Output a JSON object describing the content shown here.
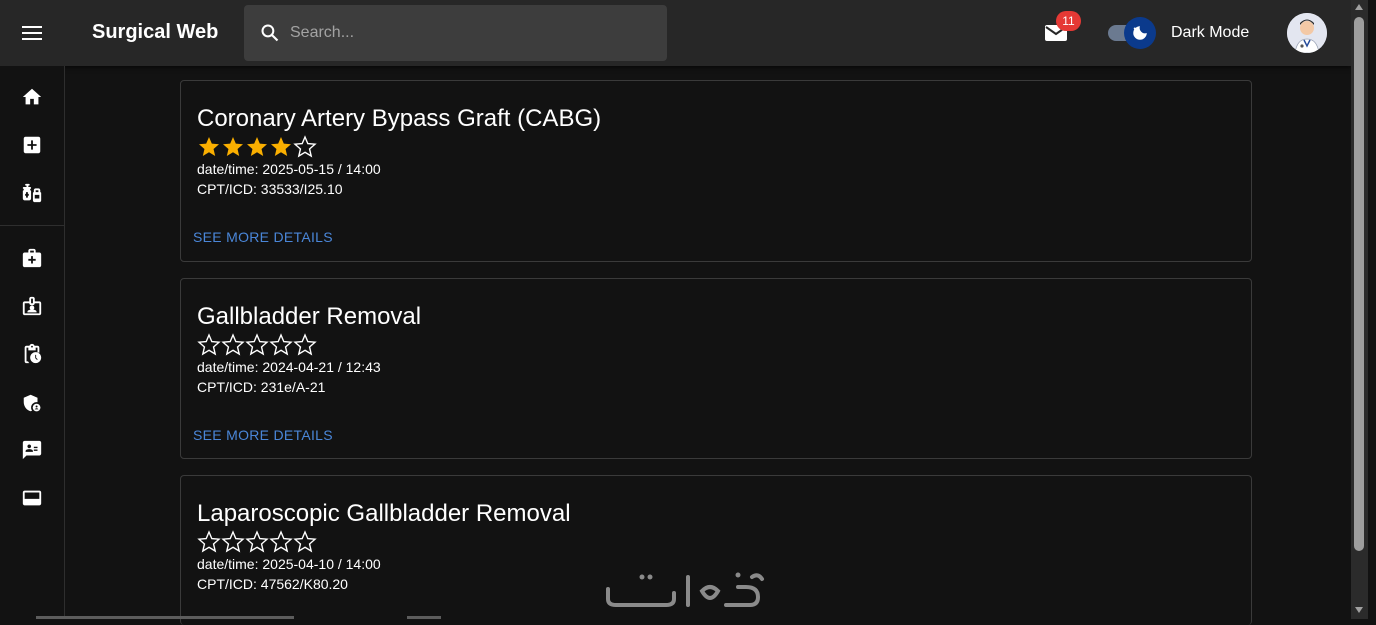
{
  "app": {
    "title": "Surgical Web"
  },
  "search": {
    "placeholder": "Search..."
  },
  "header": {
    "mail_count": "11",
    "dark_mode_label": "Dark Mode",
    "dark_mode_on": true
  },
  "sidebar": {
    "items": [
      {
        "name": "home-icon"
      },
      {
        "name": "medical-plus-icon"
      },
      {
        "name": "vaccines-icon"
      },
      {
        "name": "medical-kit-icon"
      },
      {
        "name": "badge-icon"
      },
      {
        "name": "clipboard-clock-icon"
      },
      {
        "name": "shield-icon"
      },
      {
        "name": "contact-card-icon"
      },
      {
        "name": "monitor-icon"
      }
    ]
  },
  "cards": [
    {
      "title": "Coronary Artery Bypass Graft (CABG)",
      "rating": 4,
      "max_rating": 5,
      "datetime": "date/time: 2025-05-15 / 14:00",
      "codes": "CPT/ICD: 33533/I25.10",
      "more": "SEE MORE DETAILS"
    },
    {
      "title": "Gallbladder Removal",
      "rating": 0,
      "max_rating": 5,
      "datetime": "date/time: 2024-04-21 / 12:43",
      "codes": "CPT/ICD: 231e/A-21",
      "more": "SEE MORE DETAILS"
    },
    {
      "title": "Laparoscopic Gallbladder Removal",
      "rating": 0,
      "max_rating": 5,
      "datetime": "date/time: 2025-04-10 / 14:00",
      "codes": "CPT/ICD: 47562/K80.20",
      "more": ""
    }
  ],
  "colors": {
    "star_filled": "#faaf00",
    "star_empty": "#ffffff",
    "link": "#4a86d8",
    "badge": "#e53935"
  }
}
